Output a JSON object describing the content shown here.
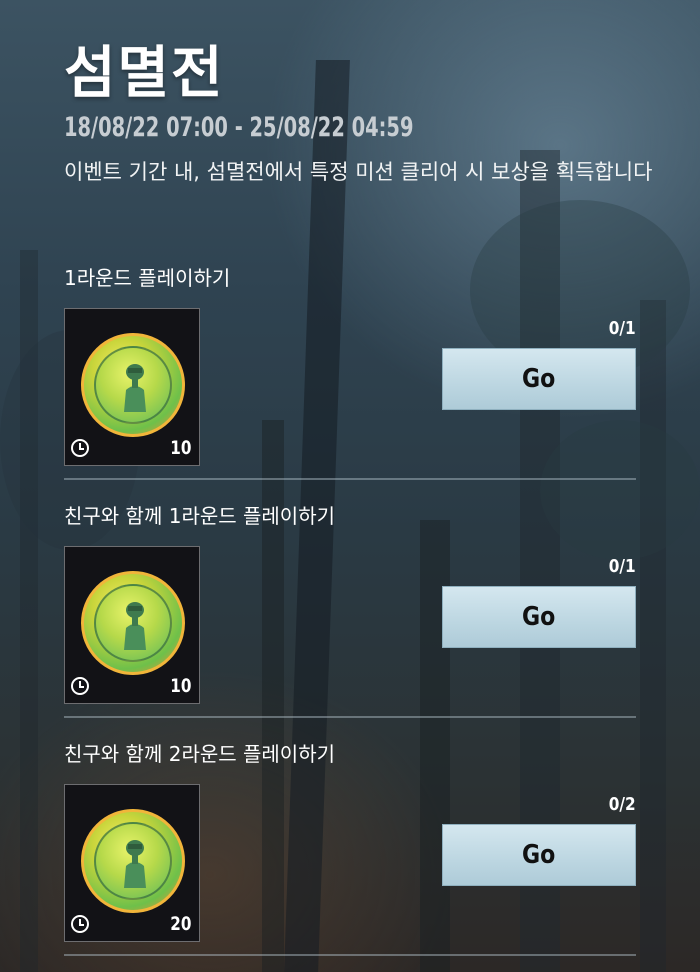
{
  "event": {
    "title": "섬멸전",
    "date_range": "18/08/22 07:00 - 25/08/22 04:59",
    "description": "이벤트 기간 내, 섬멸전에서 특정 미션 클리어 시 보상을 획득합니다"
  },
  "missions": [
    {
      "title": "1라운드 플레이하기",
      "reward_qty": "10",
      "progress": "0/1",
      "button_label": "Go"
    },
    {
      "title": "친구와 함께 1라운드 플레이하기",
      "reward_qty": "10",
      "progress": "0/1",
      "button_label": "Go"
    },
    {
      "title": "친구와 함께 2라운드 플레이하기",
      "reward_qty": "20",
      "progress": "0/2",
      "button_label": "Go"
    }
  ],
  "icons": {
    "reward": "coin-icon",
    "timer": "clock-icon"
  },
  "colors": {
    "button_bg": "#bcd6e1",
    "title_text": "#ffffff",
    "date_text": "#c7cdd2"
  }
}
